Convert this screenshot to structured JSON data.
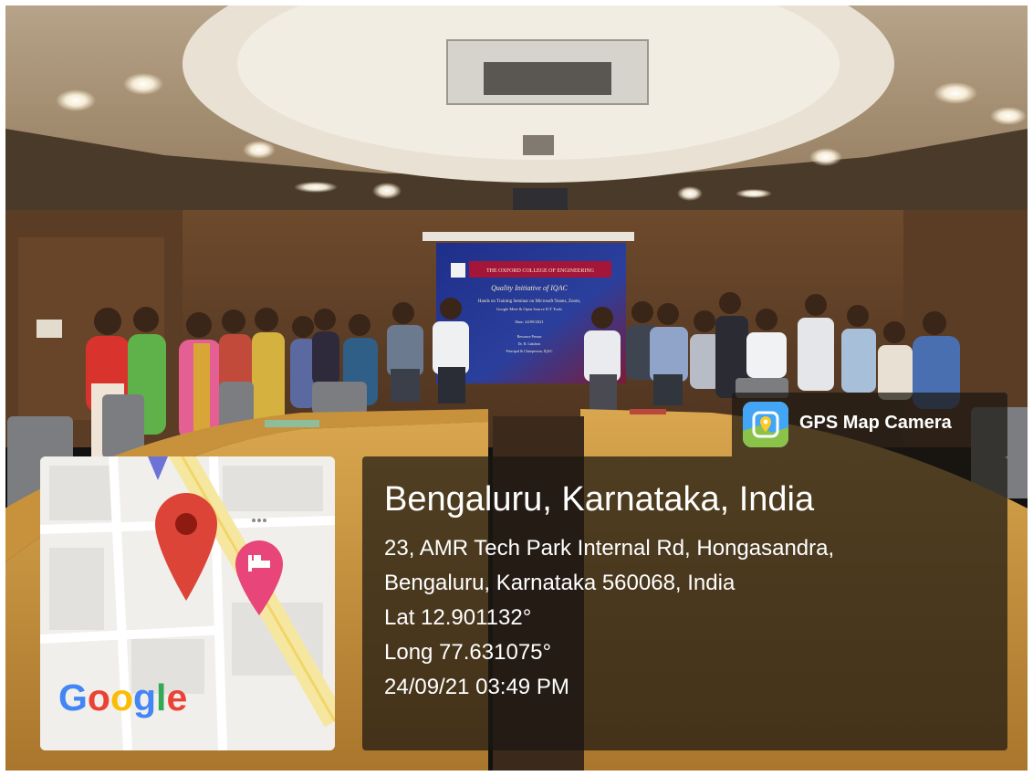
{
  "slide": {
    "college_name": "THE OXFORD COLLEGE OF ENGINEERING",
    "heading": "Quality Initiative of IQAC",
    "subheading": "Hands on Training Seminar on Microsoft Teams, Zoom,",
    "tools_line": "Google Meet & Open Source ICT Tools",
    "date_line": "Date: 24/09/2021",
    "resource_label": "Resource Person",
    "resource_name": "Dr. R. Lakshmi",
    "resource_role": "Principal & Chairperson, IQAC"
  },
  "badge": {
    "label": "GPS Map Camera",
    "icon": "gps-map-camera-icon"
  },
  "map": {
    "logo_text": "Google",
    "logo_colors": [
      "#4285F4",
      "#EA4335",
      "#FBBC05",
      "#4285F4",
      "#34A853",
      "#EA4335"
    ],
    "pin_icon": "map-pin-icon",
    "hotel_icon": "hotel-bed-icon",
    "pin_color": "#DB4437",
    "hotel_color": "#E8457A"
  },
  "location": {
    "title": "Bengaluru, Karnataka, India",
    "address_line1": "23, AMR Tech Park Internal Rd, Hongasandra,",
    "address_line2": "Bengaluru, Karnataka 560068, India",
    "latitude": "Lat 12.901132°",
    "longitude": "Long 77.631075°",
    "timestamp": "24/09/21 03:49 PM"
  }
}
